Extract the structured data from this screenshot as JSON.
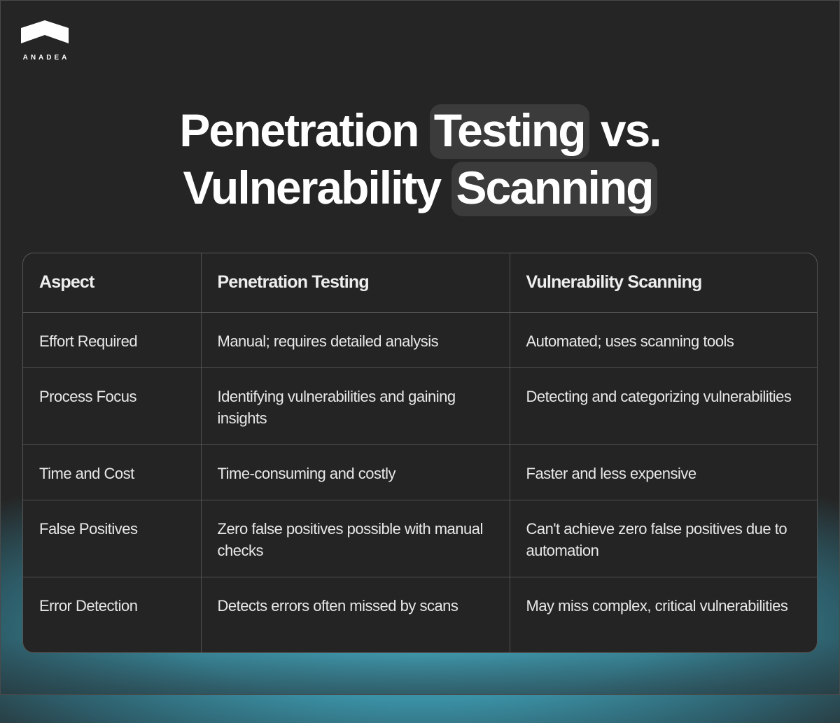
{
  "brand": {
    "name": "ANADEA",
    "logo_icon": "chevron-roof-icon"
  },
  "title": {
    "line1_prefix": "Penetration",
    "line1_highlight": "Testing",
    "line1_suffix": "vs.",
    "line2_prefix": "Vulnerability",
    "line2_highlight": "Scanning"
  },
  "colors": {
    "background": "#252525",
    "highlight": "#3b3b3b",
    "glow": "#46aec6",
    "table_border": "#555555"
  },
  "table": {
    "headers": [
      "Aspect",
      "Penetration Testing",
      "Vulnerability Scanning"
    ],
    "rows": [
      [
        "Effort Required",
        "Manual; requires detailed analysis",
        "Automated; uses scanning tools"
      ],
      [
        "Process Focus",
        "Identifying vulnerabilities and gaining insights",
        "Detecting and categorizing vulnerabilities"
      ],
      [
        "Time and Cost",
        "Time-consuming and costly",
        "Faster and less expensive"
      ],
      [
        "False Positives",
        "Zero false positives possible with manual checks",
        "Can't achieve zero false positives due to automation"
      ],
      [
        "Error Detection",
        "Detects errors often missed by scans",
        "May miss complex, critical vulnerabilities"
      ]
    ]
  }
}
